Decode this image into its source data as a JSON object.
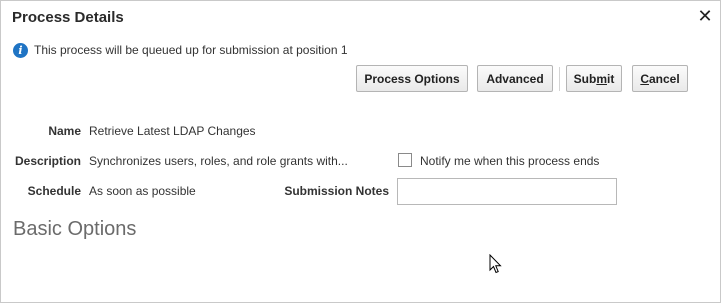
{
  "dialog": {
    "title": "Process Details",
    "close_icon": "close-icon"
  },
  "info": {
    "icon": "info-icon",
    "message": "This process will be queued up for submission at position 1"
  },
  "buttons": {
    "process_options": "Process Options",
    "advanced": "Advanced",
    "submit": "Submit",
    "cancel": "Cancel"
  },
  "form": {
    "name_label": "Name",
    "name_value": "Retrieve Latest LDAP Changes",
    "description_label": "Description",
    "description_value": "Synchronizes users, roles, and role grants with...",
    "schedule_label": "Schedule",
    "schedule_value": "As soon as possible",
    "notify_label": "Notify me when this process ends",
    "notify_checked": false,
    "submission_notes_label": "Submission Notes",
    "submission_notes_value": ""
  },
  "sections": {
    "basic_options_title": "Basic Options"
  },
  "colors": {
    "info_icon": "#1f74c4",
    "section_title": "#6b6b6b"
  }
}
